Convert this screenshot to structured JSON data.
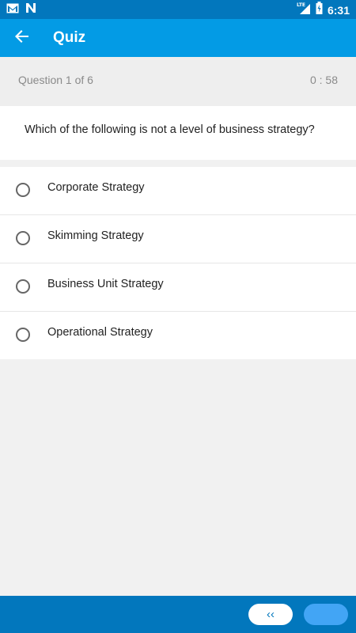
{
  "status_bar": {
    "time": "6:31",
    "network": "LTE",
    "icons": [
      "gmail-icon",
      "n-notification-icon",
      "signal-icon",
      "battery-icon"
    ]
  },
  "app_bar": {
    "title": "Quiz",
    "back_icon": "arrow-left-icon"
  },
  "quiz": {
    "question_counter": "Question 1 of  6",
    "timer": "0 : 58",
    "question": "Which of the following is not a level of business strategy?",
    "options": [
      {
        "label": "Corporate Strategy",
        "selected": false
      },
      {
        "label": "Skimming Strategy",
        "selected": false
      },
      {
        "label": "Business Unit Strategy",
        "selected": false
      },
      {
        "label": "Operational Strategy",
        "selected": false
      }
    ]
  },
  "bottom_bar": {
    "prev_label": "‹‹",
    "next_label": ""
  },
  "colors": {
    "status_bar": "#0277bd",
    "app_bar": "#039be5",
    "bottom_bar": "#0277bd",
    "next_button": "#42a5f5"
  }
}
